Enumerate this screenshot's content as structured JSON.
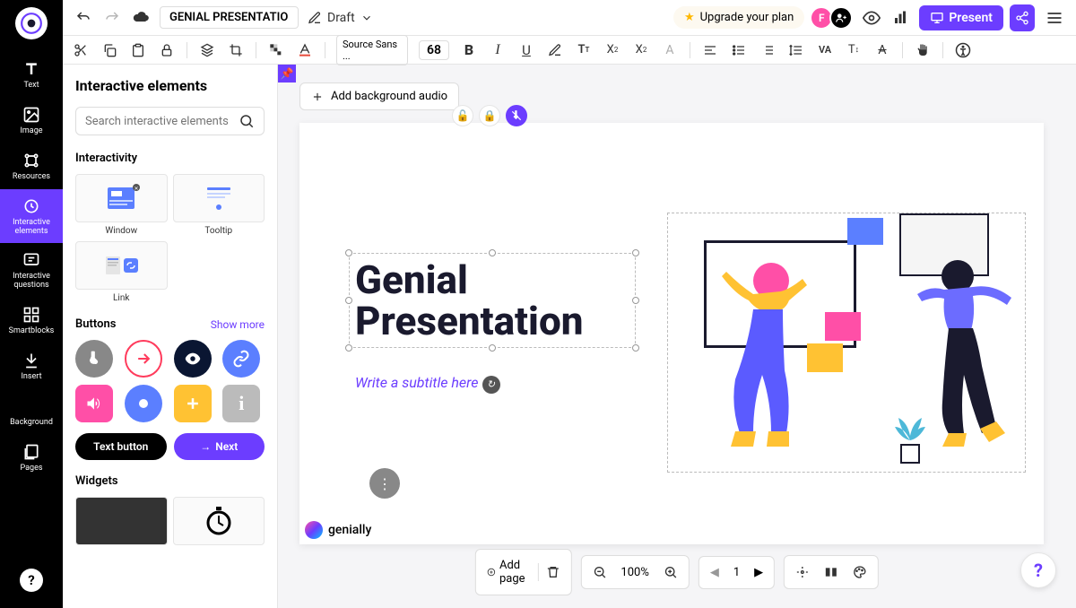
{
  "header": {
    "title": "GENIAL PRESENTATION",
    "status": "Draft",
    "upgrade": "Upgrade your plan",
    "present": "Present",
    "avatar1": "F"
  },
  "toolbar": {
    "font_family": "Source Sans ...",
    "font_size": "68"
  },
  "leftnav": {
    "items": [
      {
        "label": "Text"
      },
      {
        "label": "Image"
      },
      {
        "label": "Resources"
      },
      {
        "label": "Interactive elements"
      },
      {
        "label": "Interactive questions"
      },
      {
        "label": "Smartblocks"
      },
      {
        "label": "Insert"
      },
      {
        "label": "Background"
      },
      {
        "label": "Pages"
      }
    ]
  },
  "panel": {
    "title": "Interactive elements",
    "search_placeholder": "Search interactive elements",
    "section_interactivity": "Interactivity",
    "el_window": "Window",
    "el_tooltip": "Tooltip",
    "el_link": "Link",
    "section_buttons": "Buttons",
    "show_more": "Show more",
    "text_button": "Text button",
    "next_button": "Next",
    "section_widgets": "Widgets"
  },
  "canvas": {
    "add_audio": "Add background audio",
    "title": "Genial Presentation",
    "subtitle": "Write a subtitle here",
    "watermark": "genially"
  },
  "bottombar": {
    "add_page": "Add page",
    "zoom": "100%",
    "page": "1"
  }
}
